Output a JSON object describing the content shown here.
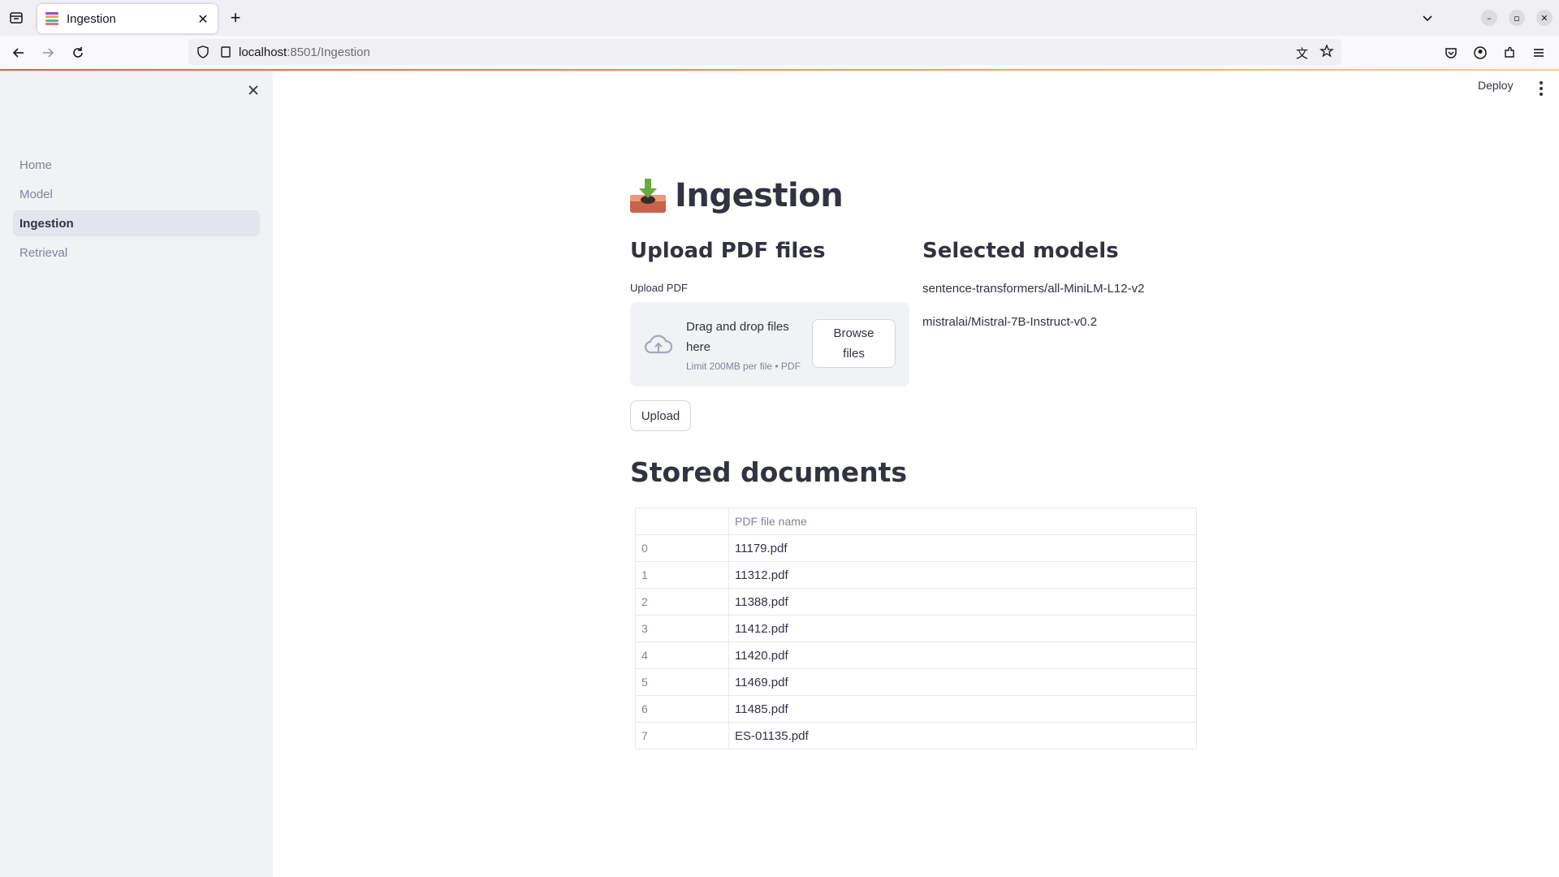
{
  "browser": {
    "tab_title": "Ingestion",
    "url_host": "localhost",
    "url_path": ":8501/Ingestion"
  },
  "sidebar": {
    "items": [
      {
        "label": "Home",
        "active": false
      },
      {
        "label": "Model",
        "active": false
      },
      {
        "label": "Ingestion",
        "active": true
      },
      {
        "label": "Retrieval",
        "active": false
      }
    ]
  },
  "header": {
    "deploy_label": "Deploy"
  },
  "main": {
    "title": "Ingestion",
    "upload_section": {
      "heading": "Upload PDF files",
      "field_label": "Upload PDF",
      "dropzone_title": "Drag and drop files here",
      "dropzone_limit": "Limit 200MB per file • PDF",
      "browse_label": "Browse files",
      "upload_label": "Upload"
    },
    "models_section": {
      "heading": "Selected models",
      "models": [
        "sentence-transformers/all-MiniLM-L12-v2",
        "mistralai/Mistral-7B-Instruct-v0.2"
      ]
    },
    "documents_section": {
      "heading": "Stored documents",
      "column_header": "PDF file name",
      "rows": [
        {
          "index": "0",
          "name": "11179.pdf"
        },
        {
          "index": "1",
          "name": "11312.pdf"
        },
        {
          "index": "2",
          "name": "11388.pdf"
        },
        {
          "index": "3",
          "name": "11412.pdf"
        },
        {
          "index": "4",
          "name": "11420.pdf"
        },
        {
          "index": "5",
          "name": "11469.pdf"
        },
        {
          "index": "6",
          "name": "11485.pdf"
        },
        {
          "index": "7",
          "name": "ES-01135.pdf"
        }
      ]
    }
  },
  "colors": {
    "accent": "#ff4b4b",
    "sidebar_bg": "#f0f2f6",
    "text": "#31333f",
    "muted": "#808495"
  }
}
